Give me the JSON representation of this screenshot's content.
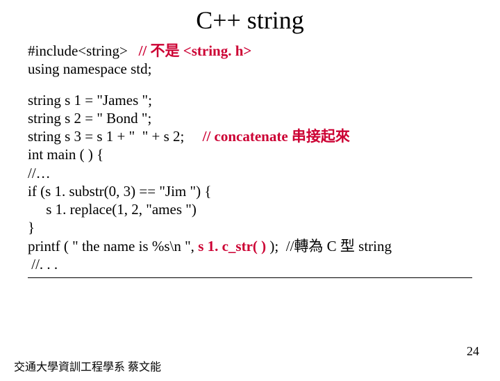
{
  "title": "C++ string",
  "lines": {
    "l1a": "#include<string>   ",
    "l1b": "// 不是 <string. h>",
    "l2": "using namespace std;",
    "l3": "string s 1 = \"James \";",
    "l4": "string s 2 = \" Bond \";",
    "l5a": "string s 3 = s 1 + \"  \" + s 2;     ",
    "l5b": "// concatenate 串接起來",
    "l6": "int main ( ) {",
    "l7": "//…",
    "l8": "if (s 1. substr(0, 3) == \"Jim \") {",
    "l9": "     s 1. replace(1, 2, \"ames \")",
    "l10": "}",
    "l11a": "printf ( \" the name is %s\\n \", ",
    "l11b": "s 1. c_str( )",
    "l11c": " );  //轉為 C 型 string",
    "l12": " //. . ."
  },
  "footer": "交通大學資訓工程學系 蔡文能",
  "page": "24"
}
